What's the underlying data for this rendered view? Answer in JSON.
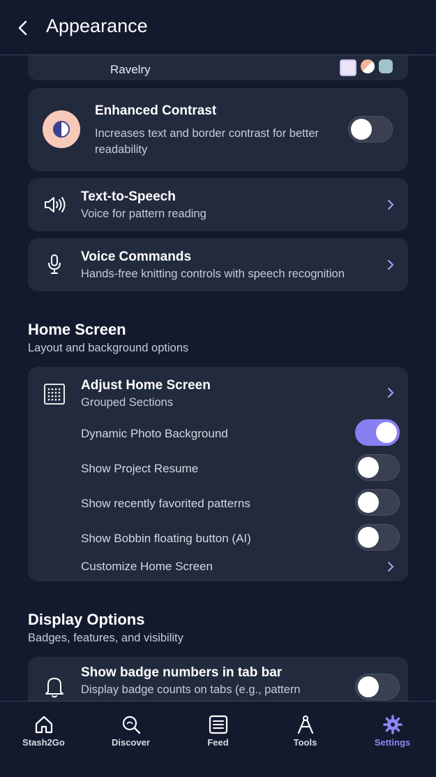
{
  "header": {
    "title": "Appearance"
  },
  "ravelry": {
    "label": "Ravelry"
  },
  "enhanced_contrast": {
    "title": "Enhanced Contrast",
    "subtitle_line1": "Increases text and border contrast for better",
    "subtitle_line2": "readability",
    "enabled": false
  },
  "tts": {
    "title": "Text-to-Speech",
    "subtitle": "Voice for pattern reading"
  },
  "voice": {
    "title": "Voice Commands",
    "subtitle": "Hands-free knitting controls with speech recognition"
  },
  "home_screen": {
    "title": "Home Screen",
    "subtitle": "Layout and background options",
    "adjust_title": "Adjust Home Screen",
    "adjust_subtitle": "Grouped Sections",
    "options": [
      {
        "label": "Dynamic Photo Background",
        "enabled": true
      },
      {
        "label": "Show Project Resume",
        "enabled": false
      },
      {
        "label": "Show recently favorited patterns",
        "enabled": false
      },
      {
        "label": "Show Bobbin floating button (AI)",
        "enabled": false
      }
    ],
    "customize_label": "Customize Home Screen"
  },
  "display_options": {
    "title": "Display Options",
    "subtitle": "Badges, features, and visibility",
    "badge_title": "Show badge numbers in tab bar",
    "badge_subtitle": "Display badge counts on tabs (e.g., pattern",
    "badge_enabled": false
  },
  "tabs": [
    {
      "label": "Stash2Go",
      "icon": "home-icon",
      "active": false
    },
    {
      "label": "Discover",
      "icon": "search-icon",
      "active": false
    },
    {
      "label": "Feed",
      "icon": "feed-icon",
      "active": false
    },
    {
      "label": "Tools",
      "icon": "tools-icon",
      "active": false
    },
    {
      "label": "Settings",
      "icon": "gear-icon",
      "active": true
    }
  ],
  "colors": {
    "background": "#141a2e",
    "card": "#222a3d",
    "accent": "#8a7ff0"
  }
}
